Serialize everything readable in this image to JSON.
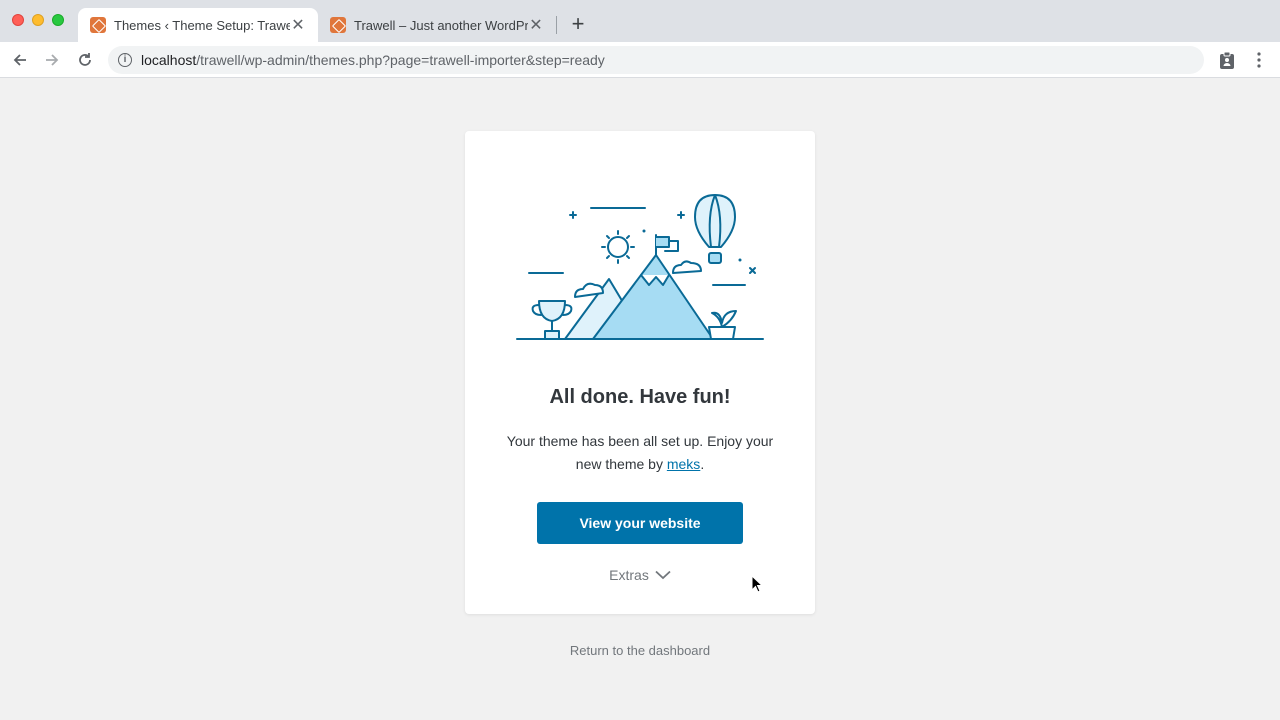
{
  "browser": {
    "tabs": [
      {
        "title": "Themes ‹ Theme Setup: Trawell",
        "active": true
      },
      {
        "title": "Trawell – Just another WordPress site",
        "active": false
      }
    ],
    "close_glyph": "✕",
    "new_tab_glyph": "+",
    "url_host": "localhost",
    "url_path": "/trawell/wp-admin/themes.php?page=trawell-importer&step=ready",
    "info_glyph": "i"
  },
  "card": {
    "title": "All done. Have fun!",
    "text_before_link": "Your theme has been all set up. Enjoy your new theme by ",
    "link_text": "meks",
    "text_after_link": ".",
    "primary_button": "View your website",
    "extras_label": "Extras"
  },
  "footer": {
    "return_link": "Return to the dashboard"
  },
  "colors": {
    "accent": "#0073aa",
    "illustration_stroke": "#0a6a96",
    "illustration_fill": "#a6dcf3"
  }
}
